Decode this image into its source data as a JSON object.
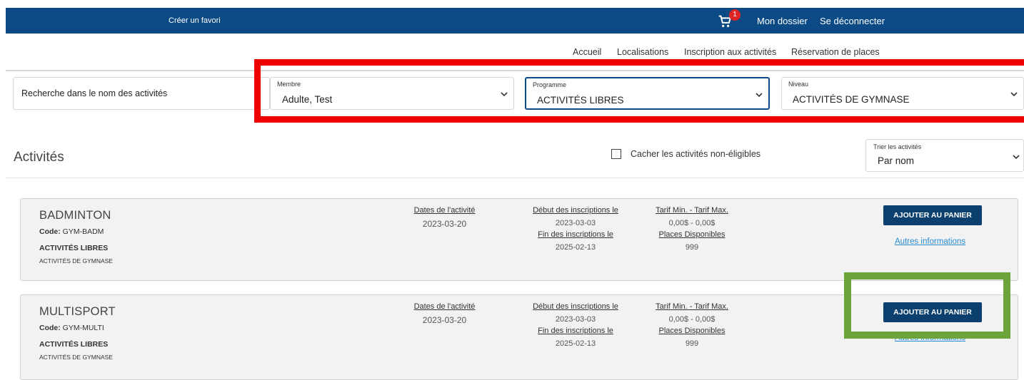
{
  "topbar": {
    "favorite": "Créer un favori",
    "cart_count": "1",
    "dossier": "Mon dossier",
    "logout": "Se déconnecter"
  },
  "nav": [
    "Accueil",
    "Localisations",
    "Inscription aux activités",
    "Réservation de places"
  ],
  "filters": {
    "search_placeholder": "Recherche dans le nom des activités",
    "membre": {
      "label": "Membre",
      "value": "Adulte, Test"
    },
    "programme": {
      "label": "Programme",
      "value": "ACTIVITÉS LIBRES"
    },
    "niveau": {
      "label": "Niveau",
      "value": "ACTIVITÉS DE GYMNASE"
    }
  },
  "section": {
    "title": "Activités",
    "hide_label": "Cacher les activités non-éligibles",
    "sort": {
      "label": "Trier les activités",
      "value": "Par nom"
    }
  },
  "headers": {
    "dates": "Dates de l'activité",
    "start": "Début des inscriptions le",
    "end": "Fin des inscriptions le",
    "tarif": "Tarif Min. - Tarif Max.",
    "places": "Places Disponibles"
  },
  "activities": [
    {
      "name": "BADMINTON",
      "code_label": "Code:",
      "code": "GYM-BADM",
      "program": "ACTIVITÉS LIBRES",
      "level": "ACTIVITÉS DE GYMNASE",
      "date": "2023-03-20",
      "start": "2023-03-03",
      "end": "2025-02-13",
      "tarif": "0,00$ - 0,00$",
      "places": "999",
      "add_label": "AJOUTER AU PANIER",
      "more_label": "Autres informations"
    },
    {
      "name": "MULTISPORT",
      "code_label": "Code:",
      "code": "GYM-MULTI",
      "program": "ACTIVITÉS LIBRES",
      "level": "ACTIVITÉS DE GYMNASE",
      "date": "2023-03-20",
      "start": "2023-03-03",
      "end": "2025-02-13",
      "tarif": "0,00$ - 0,00$",
      "places": "999",
      "add_label": "AJOUTER AU PANIER",
      "more_label": "Autres informations"
    }
  ],
  "colors": {
    "brand": "#0b4a85",
    "button": "#0b3f6e",
    "highlight_red": "#ee0000",
    "highlight_green": "#6aa43a",
    "link": "#2a8bd1"
  }
}
